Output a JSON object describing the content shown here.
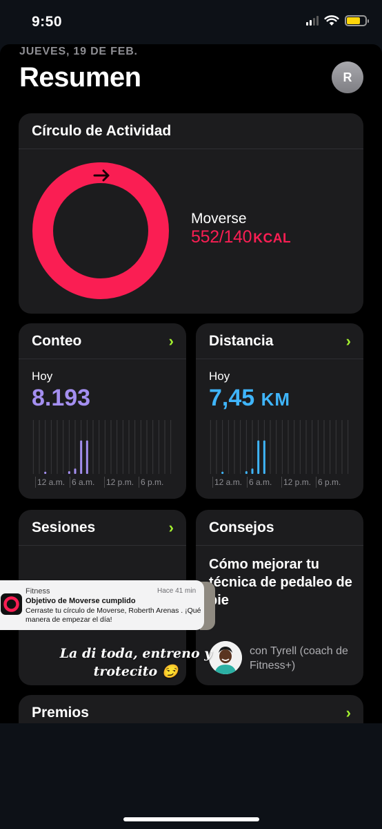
{
  "status": {
    "time": "9:50"
  },
  "header": {
    "date": "JUEVES, 19 DE FEB.",
    "title": "Resumen",
    "avatar_initial": "R"
  },
  "activity": {
    "title": "Círculo de Actividad",
    "move_label": "Moverse",
    "move_value": "552/140",
    "move_unit": "KCAL",
    "move_progress_percent": 394
  },
  "steps": {
    "title": "Conteo",
    "day_label": "Hoy",
    "value": "8.193",
    "ticks": [
      "12 a.m.",
      "6 a.m.",
      "12 p.m.",
      "6 p.m."
    ],
    "hourly_levels": [
      0,
      0,
      0.04,
      0,
      0,
      0,
      0.05,
      0.1,
      0.62,
      0.62,
      0,
      0,
      0,
      0,
      0,
      0,
      0,
      0,
      0,
      0,
      0,
      0,
      0,
      0
    ]
  },
  "distance": {
    "title": "Distancia",
    "day_label": "Hoy",
    "value": "7,45",
    "unit": "KM",
    "ticks": [
      "12 a.m.",
      "6 a.m.",
      "12 p.m.",
      "6 p.m."
    ],
    "hourly_levels": [
      0,
      0,
      0.04,
      0,
      0,
      0,
      0.05,
      0.1,
      0.62,
      0.62,
      0,
      0,
      0,
      0,
      0,
      0,
      0,
      0,
      0,
      0,
      0,
      0,
      0,
      0
    ]
  },
  "sessions": {
    "title": "Sesiones"
  },
  "tips": {
    "title": "Consejos",
    "headline": "Cómo mejorar tu técnica de pedaleo de pie",
    "coach": "con Tyrell (coach de Fitness+)"
  },
  "awards": {
    "title": "Premios"
  },
  "notification": {
    "app": "Fitness",
    "time": "Hace 41 min",
    "title": "Objetivo de Moverse cumplido",
    "body": "Cerraste tu círculo de Moverse, Roberth Arenas . ¡Qué manera de empezar el día!"
  },
  "story_caption": {
    "line1": "La di toda, entreno y",
    "line2": "trotecito 😏"
  },
  "colors": {
    "move": "#fa1e53",
    "steps": "#a48ff0",
    "distance": "#3fb5fb",
    "chevron": "#a3f12f"
  }
}
